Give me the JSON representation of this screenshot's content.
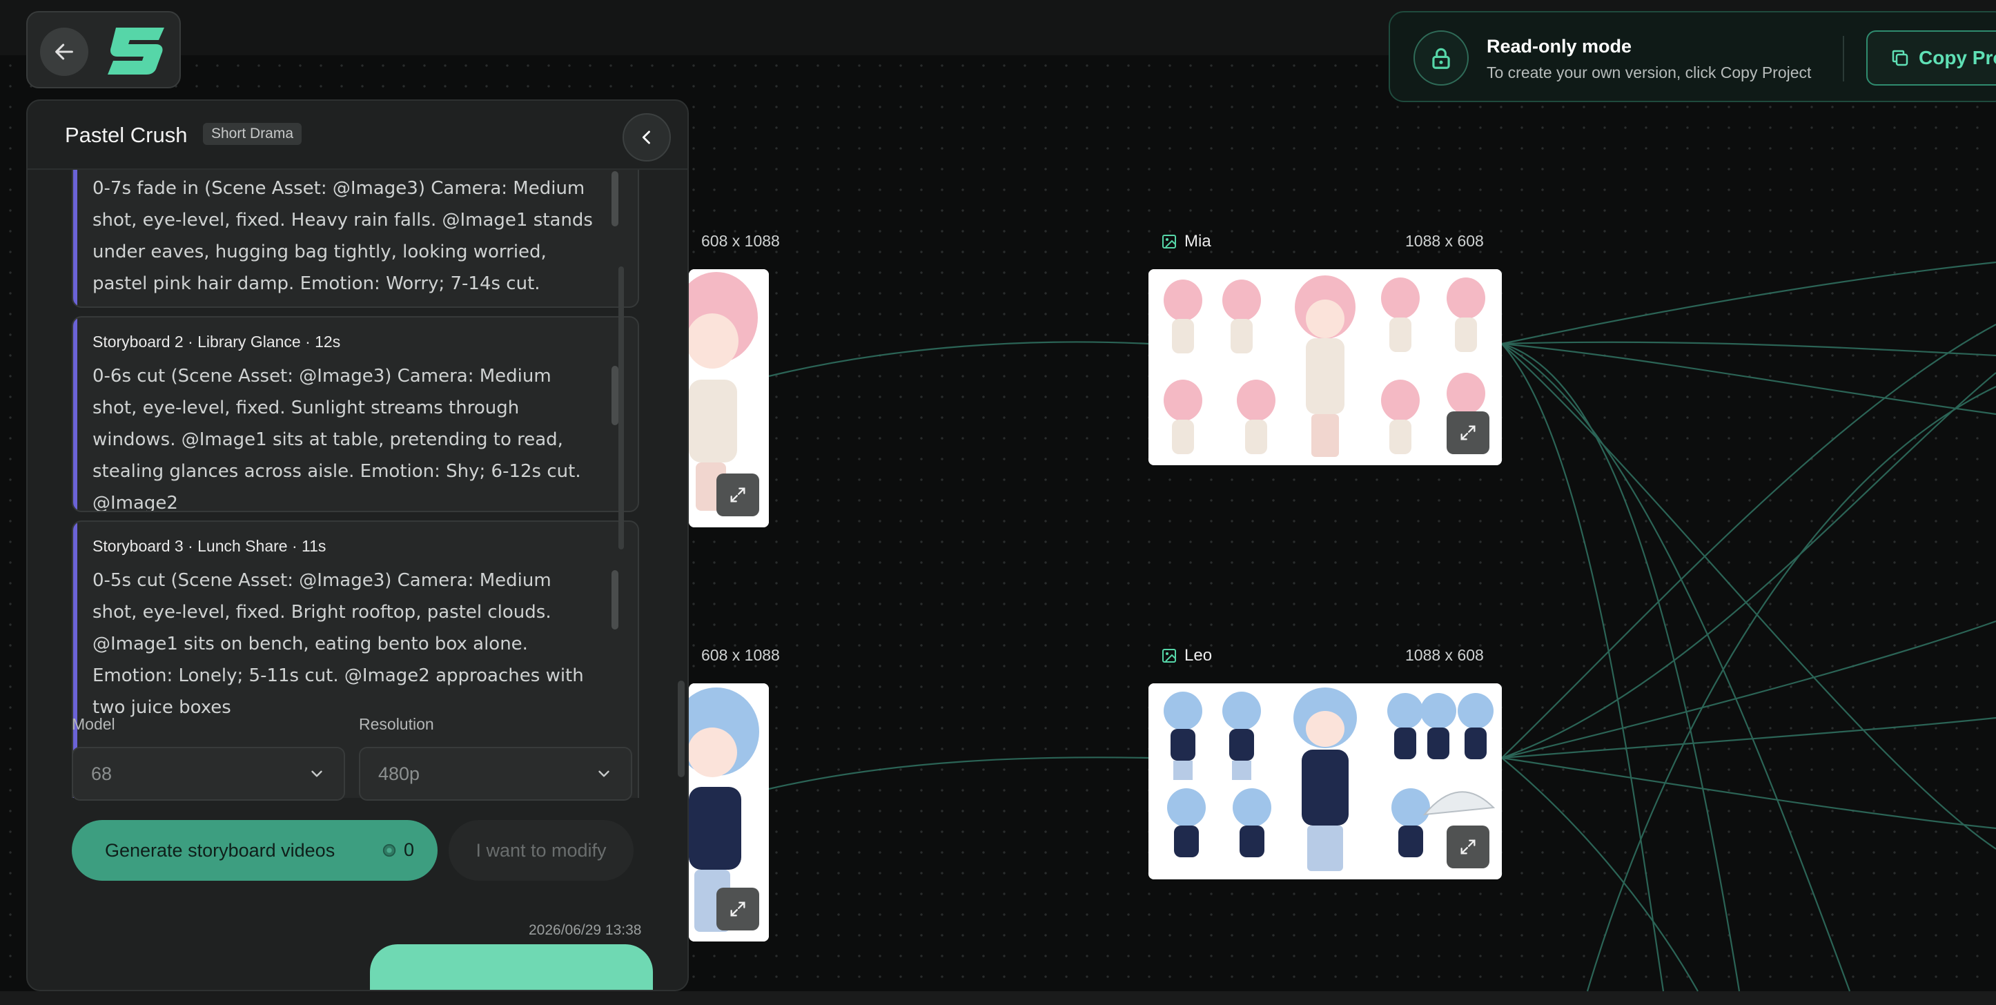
{
  "logo": {
    "back_icon": "arrow-left-icon",
    "brand_icon": "brand-s-logo"
  },
  "banner": {
    "title": "Read-only mode",
    "subtitle": "To create your own version, click Copy Project",
    "copy_button": "Copy Pro",
    "lock_icon": "lock-icon",
    "copy_icon": "copy-icon"
  },
  "panel": {
    "title": "Pastel Crush",
    "tag": "Short Drama",
    "storyboards": [
      {
        "title": "",
        "body": "0-7s fade in (Scene Asset: @Image3) Camera: Medium shot, eye-level, fixed. Heavy rain falls. @Image1 stands under eaves, hugging bag tightly, looking worried, pastel pink hair damp. Emotion: Worry; 7-14s cut. @Image2"
      },
      {
        "title": "Storyboard 2 · Library Glance · 12s",
        "body": "0-6s cut (Scene Asset: @Image3) Camera: Medium shot, eye-level, fixed. Sunlight streams through windows. @Image1 sits at table, pretending to read, stealing glances across aisle. Emotion: Shy; 6-12s cut. @Image2"
      },
      {
        "title": "Storyboard 3 · Lunch Share · 11s",
        "body": "0-5s cut (Scene Asset: @Image3) Camera: Medium shot, eye-level, fixed. Bright rooftop, pastel clouds. @Image1 sits on bench, eating bento box alone. Emotion: Lonely; 5-11s cut. @Image2 approaches with two juice boxes"
      }
    ],
    "model_label": "Model",
    "model_value": "68",
    "resolution_label": "Resolution",
    "resolution_value": "480p",
    "generate_button": "Generate storyboard videos",
    "generate_cost": "0",
    "modify_button": "I want to modify",
    "timestamp": "2026/06/29 13:38"
  },
  "nodes": {
    "top_left_size": "608 x 1088",
    "mia_label": "Mia",
    "mia_size": "1088 x 608",
    "bottom_left_size": "608 x 1088",
    "leo_label": "Leo",
    "leo_size": "1088 x 608"
  },
  "colors": {
    "accent": "#3d9e80",
    "accent_text": "#5fe0b5",
    "storyboard_bar": "#6b63d6",
    "wire": "#2f6e5e"
  }
}
